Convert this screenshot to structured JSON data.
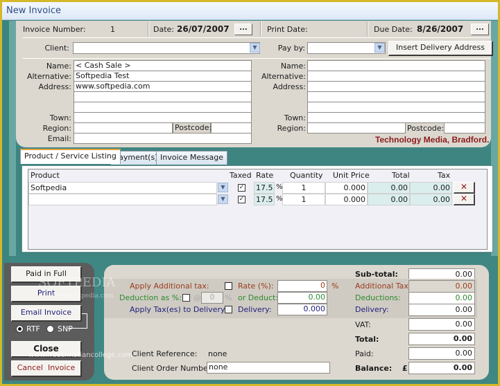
{
  "window": {
    "title": "New Invoice"
  },
  "header": {
    "invoice_number_label": "Invoice Number:",
    "invoice_number": "1",
    "date_label": "Date:",
    "date": "26/07/2007",
    "date_picker": "...",
    "print_date_label": "Print Date:",
    "print_date": "",
    "due_date_label": "Due Date:",
    "due_date": "8/26/2007",
    "due_date_picker": "..."
  },
  "client": {
    "client_label": "Client:",
    "client_value": "",
    "pay_by_label": "Pay by:",
    "pay_by_value": "",
    "insert_delivery_label": "Insert Delivery Address"
  },
  "billing": {
    "name_label": "Name:",
    "name": "< Cash Sale >",
    "alternative_label": "Alternative:",
    "alternative": "Softpedia Test",
    "address_label": "Address:",
    "address1": "www.softpedia.com",
    "address2": "",
    "address3": "",
    "town_label": "Town:",
    "town": "",
    "region_label": "Region:",
    "region": "",
    "postcode_label": "Postcode:",
    "postcode": "",
    "email_label": "Email:",
    "email": ""
  },
  "delivery": {
    "name_label": "Name:",
    "name": "",
    "alternative_label": "Alternative:",
    "alternative": "",
    "address_label": "Address:",
    "address1": "",
    "address2": "",
    "address3": "",
    "town_label": "Town:",
    "town": "",
    "region_label": "Region:",
    "region": "",
    "postcode_label": "Postcode:",
    "postcode": ""
  },
  "company": {
    "name": "Technology Media, Bradford.",
    "color": "#8b1a1a"
  },
  "tabs": [
    {
      "label": "Product / Service Listing",
      "active": true
    },
    {
      "label": "Payment(s)",
      "active": false
    },
    {
      "label": "Invoice Message",
      "active": false
    }
  ],
  "products": {
    "columns": [
      "Product",
      "Taxed",
      "Rate",
      "Quantity",
      "Unit Price",
      "Total",
      "Tax"
    ],
    "percent_sign": "%",
    "rows": [
      {
        "product": "Softpedia",
        "taxed": true,
        "rate": "17.5",
        "quantity": "1",
        "unit_price": "0.000",
        "total": "0.00",
        "tax": "0.00"
      },
      {
        "product": "",
        "taxed": true,
        "rate": "17.5",
        "quantity": "1",
        "unit_price": "0.000",
        "total": "0.00",
        "tax": "0.00"
      }
    ]
  },
  "actions": {
    "paid_in_full": "Paid in Full",
    "print": "Print",
    "email_invoice": "Email Invoice",
    "rtf_label": "RTF",
    "snp_label": "SNP",
    "format_selected": "RTF",
    "close": "Close",
    "cancel_invoice": "Cancel  Invoice"
  },
  "adjustments": {
    "apply_additional_tax_label": "Apply Additional tax:",
    "apply_additional_tax": false,
    "rate_label": "Rate (%):",
    "rate_value": "0",
    "rate_unit": "%",
    "deduction_pct_label": "Deduction as %:",
    "deduction_pct": false,
    "at_sign": "@",
    "deduction_pct_value": "0",
    "deduction_pct_unit": "%",
    "or_deduct_label": "or Deduct:",
    "or_deduct_value": "0.00",
    "apply_tax_delivery_label": "Apply Tax(es) to Delivery:",
    "apply_tax_delivery": false,
    "delivery_label": "Delivery:",
    "delivery_value": "0.000"
  },
  "reference": {
    "client_reference_label": "Client Reference:",
    "client_reference": "none",
    "client_order_label": "Client Order Number:",
    "client_order": "none"
  },
  "totals": {
    "subtotal_label": "Sub-total:",
    "subtotal": "0.00",
    "additional_tax_label": "Additional Tax:",
    "additional_tax": "0.00",
    "deductions_label": "Deductions:",
    "deductions": "0.00",
    "delivery_label": "Delivery:",
    "delivery": "0.00",
    "vat_label": "VAT:",
    "vat": "0.00",
    "total_label": "Total:",
    "total": "0.00",
    "paid_label": "Paid:",
    "paid": "0.00",
    "balance_label": "Balance:",
    "currency": "£",
    "balance": "0.00"
  },
  "colors": {
    "additional_tax": "#9a3b1b",
    "deduction": "#2c8a2c",
    "delivery": "#1e1e7a"
  },
  "watermarks": {
    "brand": "SOFTPEDIA",
    "url": "www.softpedia.com",
    "overlay": "www.freechristiancollege.com"
  }
}
